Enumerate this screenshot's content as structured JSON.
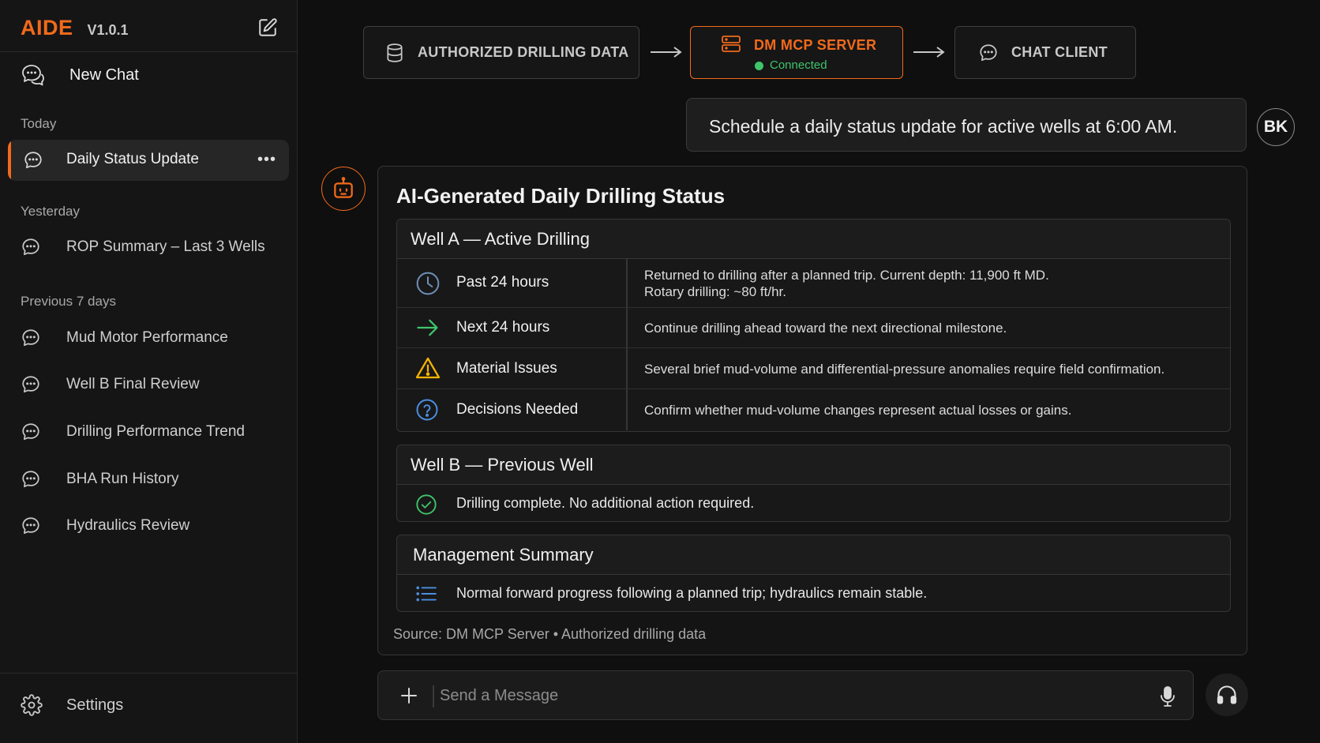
{
  "app": {
    "name": "AIDE",
    "version": "V1.0.1"
  },
  "sidebar": {
    "new_chat": "New Chat",
    "sections": {
      "today": "Today",
      "yesterday": "Yesterday",
      "previous": "Previous 7 days"
    },
    "active_chat": "Daily Status Update",
    "yesterday_items": [
      "ROP Summary – Last 3 Wells"
    ],
    "previous_items": [
      "Mud Motor Performance",
      "Well B Final Review",
      "Drilling Performance Trend",
      "BHA Run History",
      "Hydraulics Review"
    ],
    "settings": "Settings"
  },
  "pipeline": {
    "source": "AUTHORIZED DRILLING DATA",
    "server": "DM MCP SERVER",
    "server_status": "Connected",
    "client": "CHAT CLIENT"
  },
  "user": {
    "initials": "BK",
    "message": "Schedule a daily status update for active wells at 6:00 AM."
  },
  "response": {
    "title": "AI-Generated Daily Drilling Status",
    "well_a": {
      "heading": "Well A — Active Drilling",
      "rows": [
        {
          "key": "Past 24 hours",
          "line1": "Returned to drilling after a planned trip. Current depth: 11,900 ft MD.",
          "line2": "Rotary drilling: ~80 ft/hr."
        },
        {
          "key": "Next 24 hours",
          "line1": "Continue drilling ahead toward the next directional milestone."
        },
        {
          "key": "Material Issues",
          "line1": "Several brief mud-volume and differential-pressure anomalies require field confirmation."
        },
        {
          "key": "Decisions Needed",
          "line1": "Confirm whether mud-volume changes represent actual losses or gains."
        }
      ]
    },
    "well_b": {
      "heading": "Well B — Previous Well",
      "text": "Drilling complete. No additional action required."
    },
    "summary": {
      "heading": "Management Summary",
      "text": "Normal forward progress following a planned trip; hydraulics remain stable."
    },
    "source": "Source: DM MCP Server  •  Authorized drilling data"
  },
  "composer": {
    "placeholder": "Send a Message"
  },
  "colors": {
    "accent": "#f26a1b",
    "success": "#3fc56b",
    "warning": "#f5b400",
    "info": "#4a8fe0"
  }
}
